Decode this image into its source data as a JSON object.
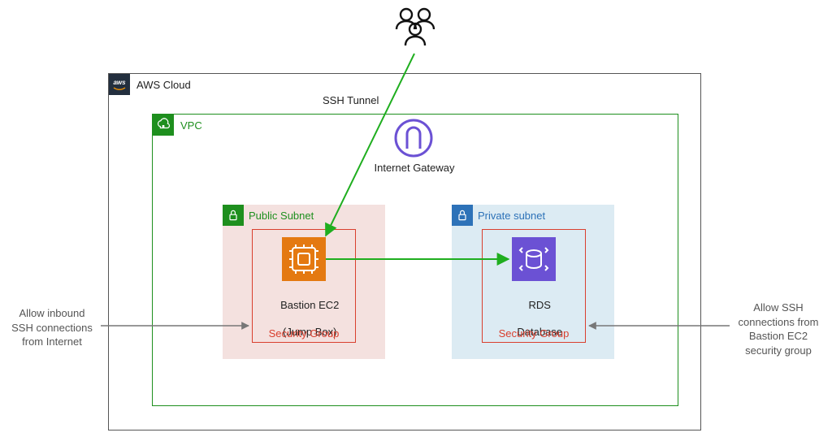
{
  "aws_label": "AWS Cloud",
  "vpc_label": "VPC",
  "ssh_tunnel": "SSH Tunnel",
  "internet_gateway": "Internet Gateway",
  "public_subnet": "Public Subnet",
  "private_subnet": "Private subnet",
  "bastion": {
    "line1": "Bastion EC2",
    "line2": "(Jump Box)"
  },
  "rds": {
    "line1": "RDS",
    "line2": "Database"
  },
  "security_group": "Security Group",
  "annotation_left": "Allow inbound\nSSH connections\nfrom Internet",
  "annotation_right": "Allow SSH\nconnections from\nBastion EC2\nsecurity group",
  "colors": {
    "aws_black": "#232f3e",
    "vpc_green": "#1e8f1e",
    "sg_red": "#d93f2e",
    "public_text": "#1e8f1e",
    "private_text": "#2d72b8",
    "orange": "#e47911",
    "purple": "#6b51d4"
  }
}
